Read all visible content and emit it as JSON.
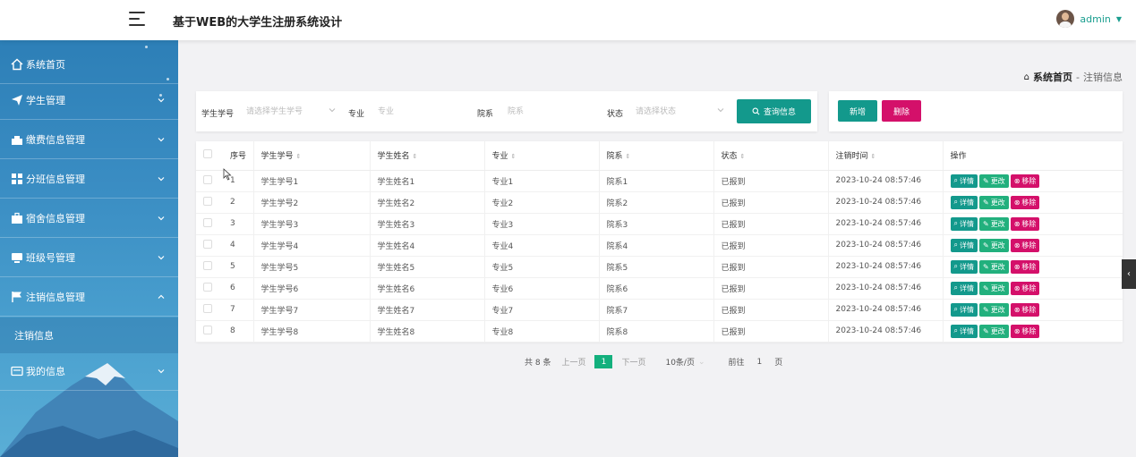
{
  "app": {
    "title": "基于WEB的大学生注册系统设计",
    "user": "admin",
    "accent": "#13998c",
    "danger": "#d4106a"
  },
  "sidebar": {
    "items": [
      {
        "label": "系统首页",
        "icon": "home-icon",
        "chevron": false
      },
      {
        "label": "学生管理",
        "icon": "send-icon",
        "chevron": true
      },
      {
        "label": "缴费信息管理",
        "icon": "bank-icon",
        "chevron": true
      },
      {
        "label": "分班信息管理",
        "icon": "grid-icon",
        "chevron": true
      },
      {
        "label": "宿舍信息管理",
        "icon": "briefcase-icon",
        "chevron": true
      },
      {
        "label": "班级号管理",
        "icon": "monitor-icon",
        "chevron": true
      },
      {
        "label": "注销信息管理",
        "icon": "flag-icon",
        "chevron": true
      },
      {
        "label": "注销信息",
        "icon": "",
        "chevron": false,
        "sub": true
      },
      {
        "label": "我的信息",
        "icon": "card-icon",
        "chevron": true
      }
    ]
  },
  "breadcrumb": {
    "home": "系统首页",
    "sep": "-",
    "current": "注销信息"
  },
  "search": {
    "student_no_label": "学生学号",
    "student_no_placeholder": "请选择学生学号",
    "major_label": "专业",
    "major_placeholder": "专业",
    "college_label": "院系",
    "college_placeholder": "院系",
    "status_label": "状态",
    "status_placeholder": "请选择状态",
    "query_button": "查询信息"
  },
  "actions": {
    "add": "新增",
    "delete": "删除"
  },
  "table": {
    "headers": [
      "序号",
      "学生学号",
      "学生姓名",
      "专业",
      "院系",
      "状态",
      "注销时间",
      "操作"
    ],
    "rows": [
      [
        "1",
        "学生学号1",
        "学生姓名1",
        "专业1",
        "院系1",
        "已报到",
        "2023-10-24 08:57:46"
      ],
      [
        "2",
        "学生学号2",
        "学生姓名2",
        "专业2",
        "院系2",
        "已报到",
        "2023-10-24 08:57:46"
      ],
      [
        "3",
        "学生学号3",
        "学生姓名3",
        "专业3",
        "院系3",
        "已报到",
        "2023-10-24 08:57:46"
      ],
      [
        "4",
        "学生学号4",
        "学生姓名4",
        "专业4",
        "院系4",
        "已报到",
        "2023-10-24 08:57:46"
      ],
      [
        "5",
        "学生学号5",
        "学生姓名5",
        "专业5",
        "院系5",
        "已报到",
        "2023-10-24 08:57:46"
      ],
      [
        "6",
        "学生学号6",
        "学生姓名6",
        "专业6",
        "院系6",
        "已报到",
        "2023-10-24 08:57:46"
      ],
      [
        "7",
        "学生学号7",
        "学生姓名7",
        "专业7",
        "院系7",
        "已报到",
        "2023-10-24 08:57:46"
      ],
      [
        "8",
        "学生学号8",
        "学生姓名8",
        "专业8",
        "院系8",
        "已报到",
        "2023-10-24 08:57:46"
      ]
    ],
    "op_detail": "详情",
    "op_edit": "更改",
    "op_remove": "移除"
  },
  "pager": {
    "total": "共 8 条",
    "prev": "上一页",
    "current": "1",
    "next": "下一页",
    "page_size": "10条/页",
    "goto_label": "前往",
    "goto_value": "1",
    "goto_unit": "页"
  }
}
